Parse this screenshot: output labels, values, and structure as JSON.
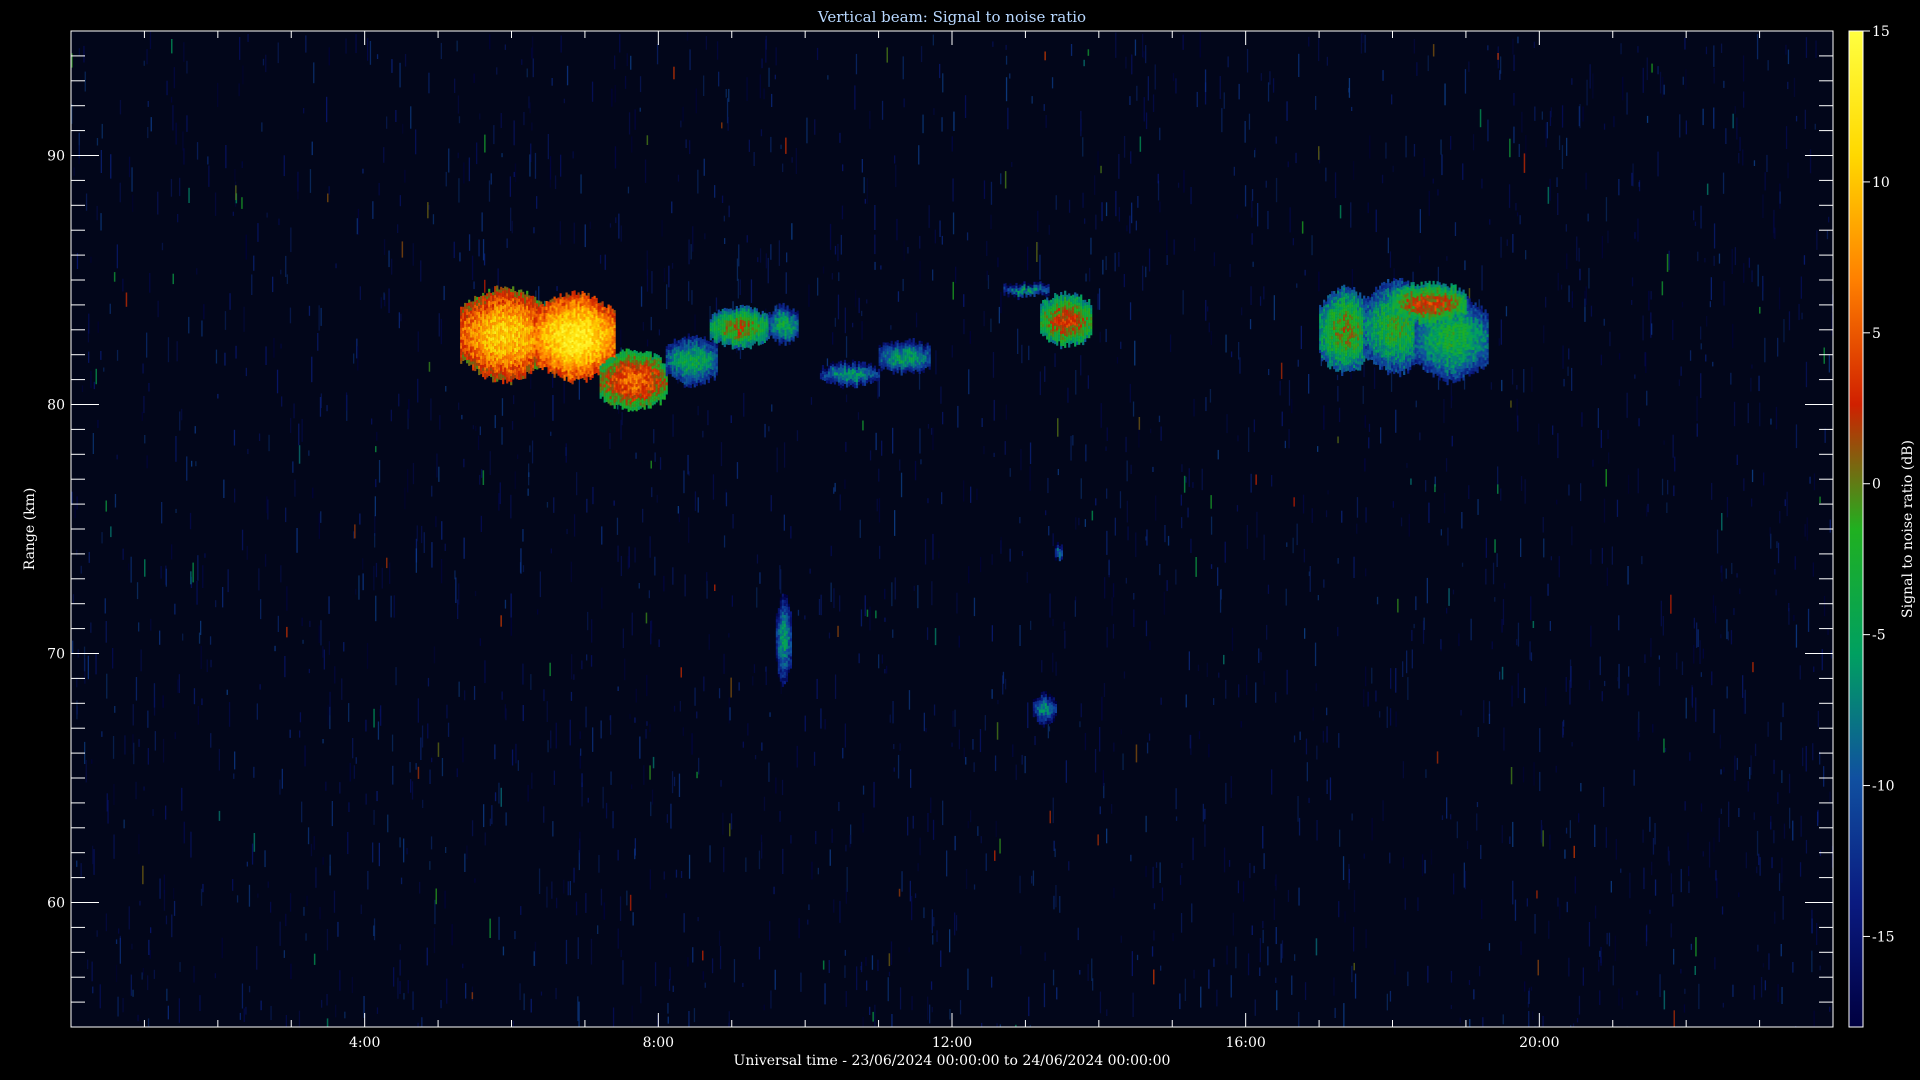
{
  "chart_data": {
    "type": "heatmap",
    "title": "Vertical beam: Signal to noise ratio",
    "xlabel": "Universal time - 23/06/2024 00:00:00 to 24/06/2024 00:00:00",
    "ylabel": "Range (km)",
    "colorbar_label": "Signal to noise ratio (dB)",
    "x_unit": "hours UT",
    "xlim": [
      0,
      24
    ],
    "ylim": [
      55,
      95
    ],
    "x_ticks": [
      {
        "value": 4,
        "label": "4:00"
      },
      {
        "value": 8,
        "label": "8:00"
      },
      {
        "value": 12,
        "label": "12:00"
      },
      {
        "value": 16,
        "label": "16:00"
      },
      {
        "value": 20,
        "label": "20:00"
      }
    ],
    "y_ticks": [
      {
        "value": 60,
        "label": "60"
      },
      {
        "value": 70,
        "label": "70"
      },
      {
        "value": 80,
        "label": "80"
      },
      {
        "value": 90,
        "label": "90"
      }
    ],
    "colorbar_range": [
      -18,
      15
    ],
    "colorbar_ticks": [
      {
        "value": 15,
        "label": "15"
      },
      {
        "value": 10,
        "label": "10"
      },
      {
        "value": 5,
        "label": "5"
      },
      {
        "value": 0,
        "label": "0"
      },
      {
        "value": -5,
        "label": "-5"
      },
      {
        "value": -10,
        "label": "-10"
      },
      {
        "value": -15,
        "label": "-15"
      }
    ],
    "colorscale": [
      "#000040",
      "#0a1a80",
      "#1050a0",
      "#00a060",
      "#20b020",
      "#d02000",
      "#ff8000",
      "#ffd800",
      "#ffff40"
    ],
    "features": [
      {
        "t_start": 5.3,
        "t_end": 6.5,
        "r_low": 81.0,
        "r_high": 84.7,
        "snr": 11
      },
      {
        "t_start": 6.3,
        "t_end": 7.4,
        "r_low": 81.0,
        "r_high": 84.5,
        "snr": 13
      },
      {
        "t_start": 7.2,
        "t_end": 8.1,
        "r_low": 79.8,
        "r_high": 82.2,
        "snr": 6
      },
      {
        "t_start": 8.1,
        "t_end": 8.8,
        "r_low": 80.8,
        "r_high": 82.8,
        "snr": -4
      },
      {
        "t_start": 8.7,
        "t_end": 9.5,
        "r_low": 82.3,
        "r_high": 83.9,
        "snr": 1
      },
      {
        "t_start": 9.5,
        "t_end": 9.9,
        "r_low": 82.5,
        "r_high": 84.0,
        "snr": -4
      },
      {
        "t_start": 10.2,
        "t_end": 11.0,
        "r_low": 80.8,
        "r_high": 81.7,
        "snr": -6
      },
      {
        "t_start": 11.0,
        "t_end": 11.7,
        "r_low": 81.3,
        "r_high": 82.6,
        "snr": -5
      },
      {
        "t_start": 12.7,
        "t_end": 13.3,
        "r_low": 84.4,
        "r_high": 84.9,
        "snr": -6
      },
      {
        "t_start": 13.2,
        "t_end": 13.9,
        "r_low": 82.4,
        "r_high": 84.5,
        "snr": 3
      },
      {
        "t_start": 17.0,
        "t_end": 17.7,
        "r_low": 81.3,
        "r_high": 84.7,
        "snr": 0
      },
      {
        "t_start": 17.6,
        "t_end": 18.5,
        "r_low": 81.3,
        "r_high": 85.0,
        "snr": -2
      },
      {
        "t_start": 18.3,
        "t_end": 19.3,
        "r_low": 81.0,
        "r_high": 84.4,
        "snr": -3
      },
      {
        "t_start": 18.0,
        "t_end": 19.0,
        "r_low": 83.3,
        "r_high": 84.9,
        "snr": 3
      },
      {
        "t_start": 9.6,
        "t_end": 9.8,
        "r_low": 68.8,
        "r_high": 72.4,
        "snr": -6
      },
      {
        "t_start": 13.1,
        "t_end": 13.4,
        "r_low": 67.2,
        "r_high": 68.4,
        "snr": -7
      },
      {
        "t_start": 13.4,
        "t_end": 13.5,
        "r_low": 73.8,
        "r_high": 74.4,
        "snr": -7
      }
    ]
  }
}
